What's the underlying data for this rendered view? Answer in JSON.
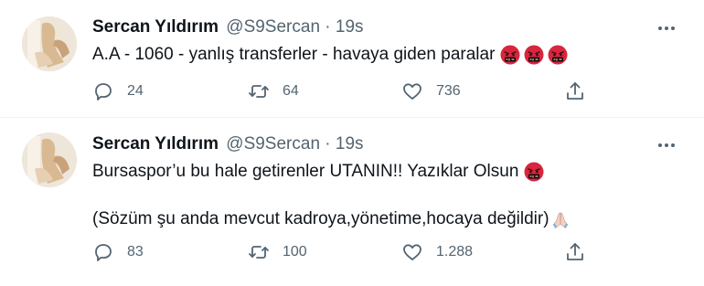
{
  "tweets": [
    {
      "author_name": "Sercan Yıldırım",
      "author_handle": "@S9Sercan",
      "separator": "·",
      "time": "19s",
      "paragraphs": [
        {
          "text": "A.A - 1060 - yanlış transferler - havaya giden paralar",
          "emoji": [
            "angry-face-with-symbols-icon",
            "angry-face-with-symbols-icon",
            "angry-face-with-symbols-icon"
          ]
        }
      ],
      "replies": "24",
      "retweets": "64",
      "likes": "736"
    },
    {
      "author_name": "Sercan Yıldırım",
      "author_handle": "@S9Sercan",
      "separator": "·",
      "time": "19s",
      "paragraphs": [
        {
          "text": "Bursaspor’u bu hale getirenler UTANIN!! Yazıklar Olsun",
          "emoji": [
            "angry-face-with-symbols-icon"
          ]
        },
        {
          "text": "(Sözüm şu anda mevcut kadroya,yönetime,hocaya değildir)",
          "emoji": [
            "folded-hands-icon"
          ]
        }
      ],
      "replies": "83",
      "retweets": "100",
      "likes": "1.288"
    }
  ],
  "icons": {
    "reply": "reply-icon",
    "retweet": "retweet-icon",
    "like": "heart-icon",
    "share": "share-icon",
    "more": "more-icon"
  },
  "colors": {
    "text": "#0f1419",
    "secondary": "#536471",
    "divider": "#eff3f4",
    "angry_emoji": "#d7263d"
  }
}
